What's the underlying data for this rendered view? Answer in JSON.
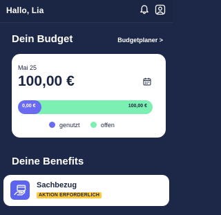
{
  "header": {
    "greeting": "Hallo, Lia",
    "icons": [
      "bell-icon",
      "user-icon"
    ]
  },
  "budget": {
    "title": "Dein Budget",
    "planner_link": "Budgetplaner >",
    "card": {
      "date": "Mai 25",
      "amount": "100,00 €",
      "icon": "calendar-icon",
      "used_label": "0,00 €",
      "free_label": "100,00 €",
      "used_fraction": 0,
      "legend": [
        {
          "label": "genutzt",
          "color": "#6a6bf2"
        },
        {
          "label": "offen",
          "color": "#7bf0b2"
        }
      ]
    }
  },
  "benefits": {
    "title": "Deine Benefits",
    "items": [
      {
        "name": "Sachbezug",
        "badge": "AKTION ERFORDERLICH",
        "icon": "card-hand-icon",
        "icon_color": "#5b63ef",
        "badge_color": "#ffc93c"
      }
    ]
  },
  "colors": {
    "background": "#1d2747",
    "card": "#ffffff",
    "text_dark": "#1c2540"
  }
}
